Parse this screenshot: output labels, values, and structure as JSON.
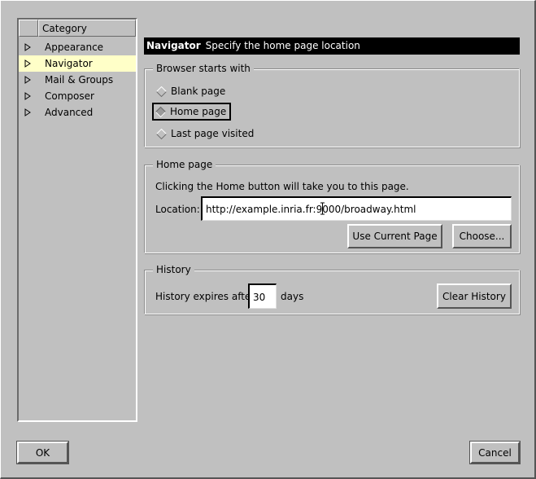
{
  "sidebar": {
    "header": "Category",
    "items": [
      {
        "label": "Appearance",
        "selected": false
      },
      {
        "label": "Navigator",
        "selected": true
      },
      {
        "label": "Mail & Groups",
        "selected": false
      },
      {
        "label": "Composer",
        "selected": false
      },
      {
        "label": "Advanced",
        "selected": false
      }
    ]
  },
  "banner": {
    "title": "Navigator",
    "subtitle": "Specify the home page location"
  },
  "startup": {
    "legend": "Browser starts with",
    "options": [
      {
        "label": "Blank page",
        "selected": false
      },
      {
        "label": "Home page",
        "selected": true
      },
      {
        "label": "Last page visited",
        "selected": false
      }
    ]
  },
  "homepage": {
    "legend": "Home page",
    "description": "Clicking the Home button will take you to this page.",
    "location_label": "Location:",
    "location_value": "http://example.inria.fr:9000/broadway.html",
    "use_current_label": "Use Current Page",
    "choose_label": "Choose..."
  },
  "history": {
    "legend": "History",
    "expires_label": "History expires after",
    "days_value": "30",
    "days_label": "days",
    "clear_label": "Clear History"
  },
  "footer": {
    "ok_label": "OK",
    "cancel_label": "Cancel"
  },
  "colors": {
    "window_bg": "#c0c0c0",
    "selected_row": "#ffffc8",
    "banner_bg": "#000000"
  }
}
